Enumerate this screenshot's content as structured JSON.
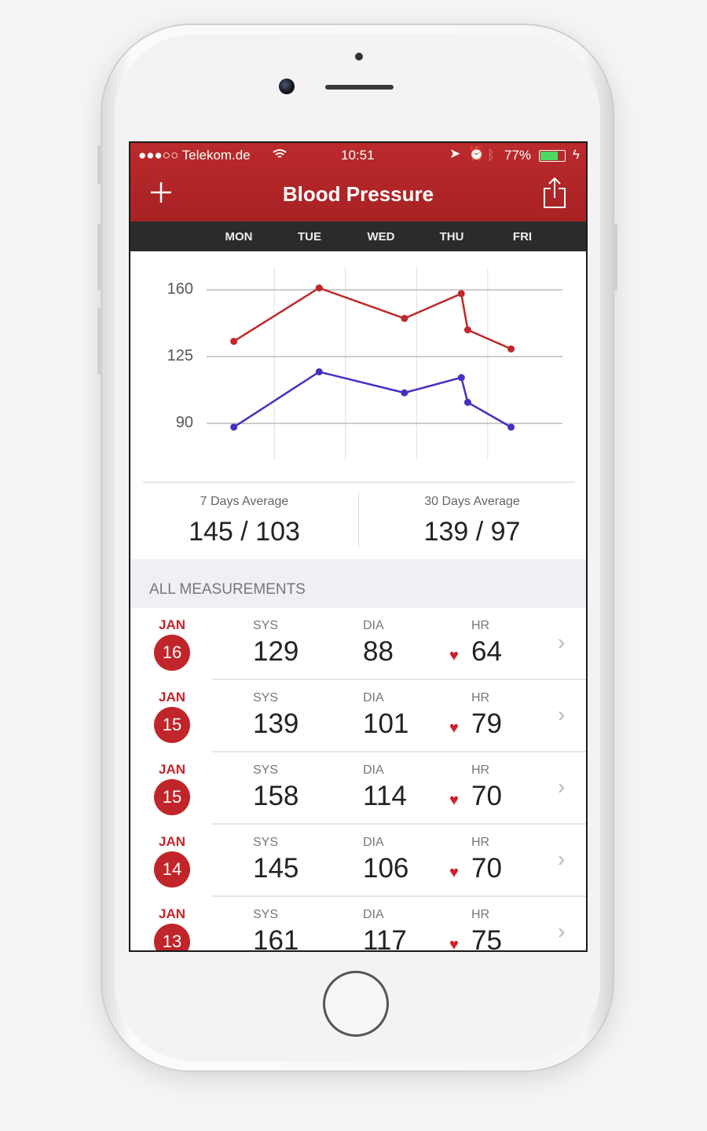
{
  "status_bar": {
    "carrier": "●●●○○ Telekom.de",
    "time": "10:51",
    "battery": "77%"
  },
  "nav": {
    "title": "Blood Pressure",
    "add_icon": "plus-icon",
    "share_icon": "share-icon"
  },
  "colors": {
    "brand": "#b8282a",
    "systolic": "#c0282a",
    "diastolic": "#4a2ec0",
    "daybar": "#2b2b2b"
  },
  "chart_data": {
    "type": "line",
    "categories": [
      "MON",
      "TUE",
      "WED",
      "THU",
      "FRI"
    ],
    "yticks": [
      90,
      125,
      160
    ],
    "grid": true,
    "series": [
      {
        "key": "sys",
        "x": [
          -0.07,
          1.13,
          2.33,
          3.13,
          3.22,
          3.83
        ],
        "values": [
          133,
          161,
          145,
          158,
          139,
          129
        ]
      },
      {
        "key": "dia",
        "x": [
          -0.07,
          1.13,
          2.33,
          3.13,
          3.22,
          3.83
        ],
        "values": [
          88,
          117,
          106,
          114,
          101,
          88
        ]
      }
    ]
  },
  "averages": [
    {
      "label": "7 Days Average",
      "value": "145 / 103"
    },
    {
      "label": "30 Days Average",
      "value": "139 / 97"
    }
  ],
  "section_title": "ALL MEASUREMENTS",
  "labels": {
    "sys": "SYS",
    "dia": "DIA",
    "hr": "HR"
  },
  "measurements": [
    {
      "month": "JAN",
      "day": "16",
      "sys": "129",
      "dia": "88",
      "hr": "64"
    },
    {
      "month": "JAN",
      "day": "15",
      "sys": "139",
      "dia": "101",
      "hr": "79"
    },
    {
      "month": "JAN",
      "day": "15",
      "sys": "158",
      "dia": "114",
      "hr": "70"
    },
    {
      "month": "JAN",
      "day": "14",
      "sys": "145",
      "dia": "106",
      "hr": "70"
    },
    {
      "month": "JAN",
      "day": "13",
      "sys": "161",
      "dia": "117",
      "hr": "75"
    }
  ]
}
